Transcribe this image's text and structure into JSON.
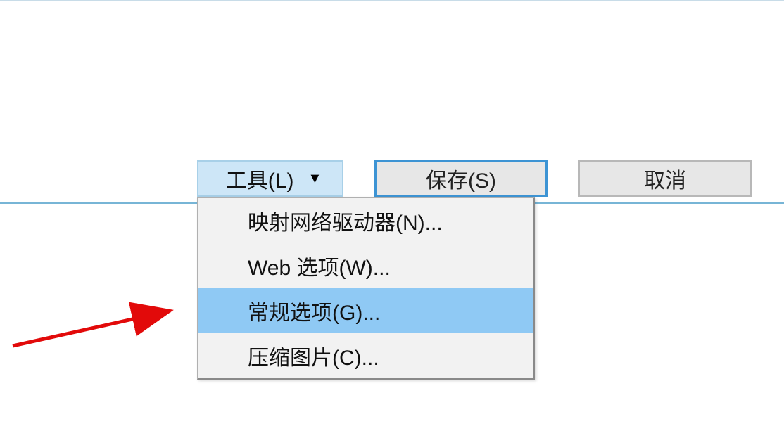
{
  "buttons": {
    "tools_label": "工具(L)",
    "save_label": "保存(S)",
    "cancel_label": "取消"
  },
  "menu": {
    "items": [
      {
        "label": "映射网络驱动器(N)...",
        "highlighted": false
      },
      {
        "label": "Web 选项(W)...",
        "highlighted": false
      },
      {
        "label": "常规选项(G)...",
        "highlighted": true
      },
      {
        "label": "压缩图片(C)...",
        "highlighted": false
      }
    ]
  }
}
